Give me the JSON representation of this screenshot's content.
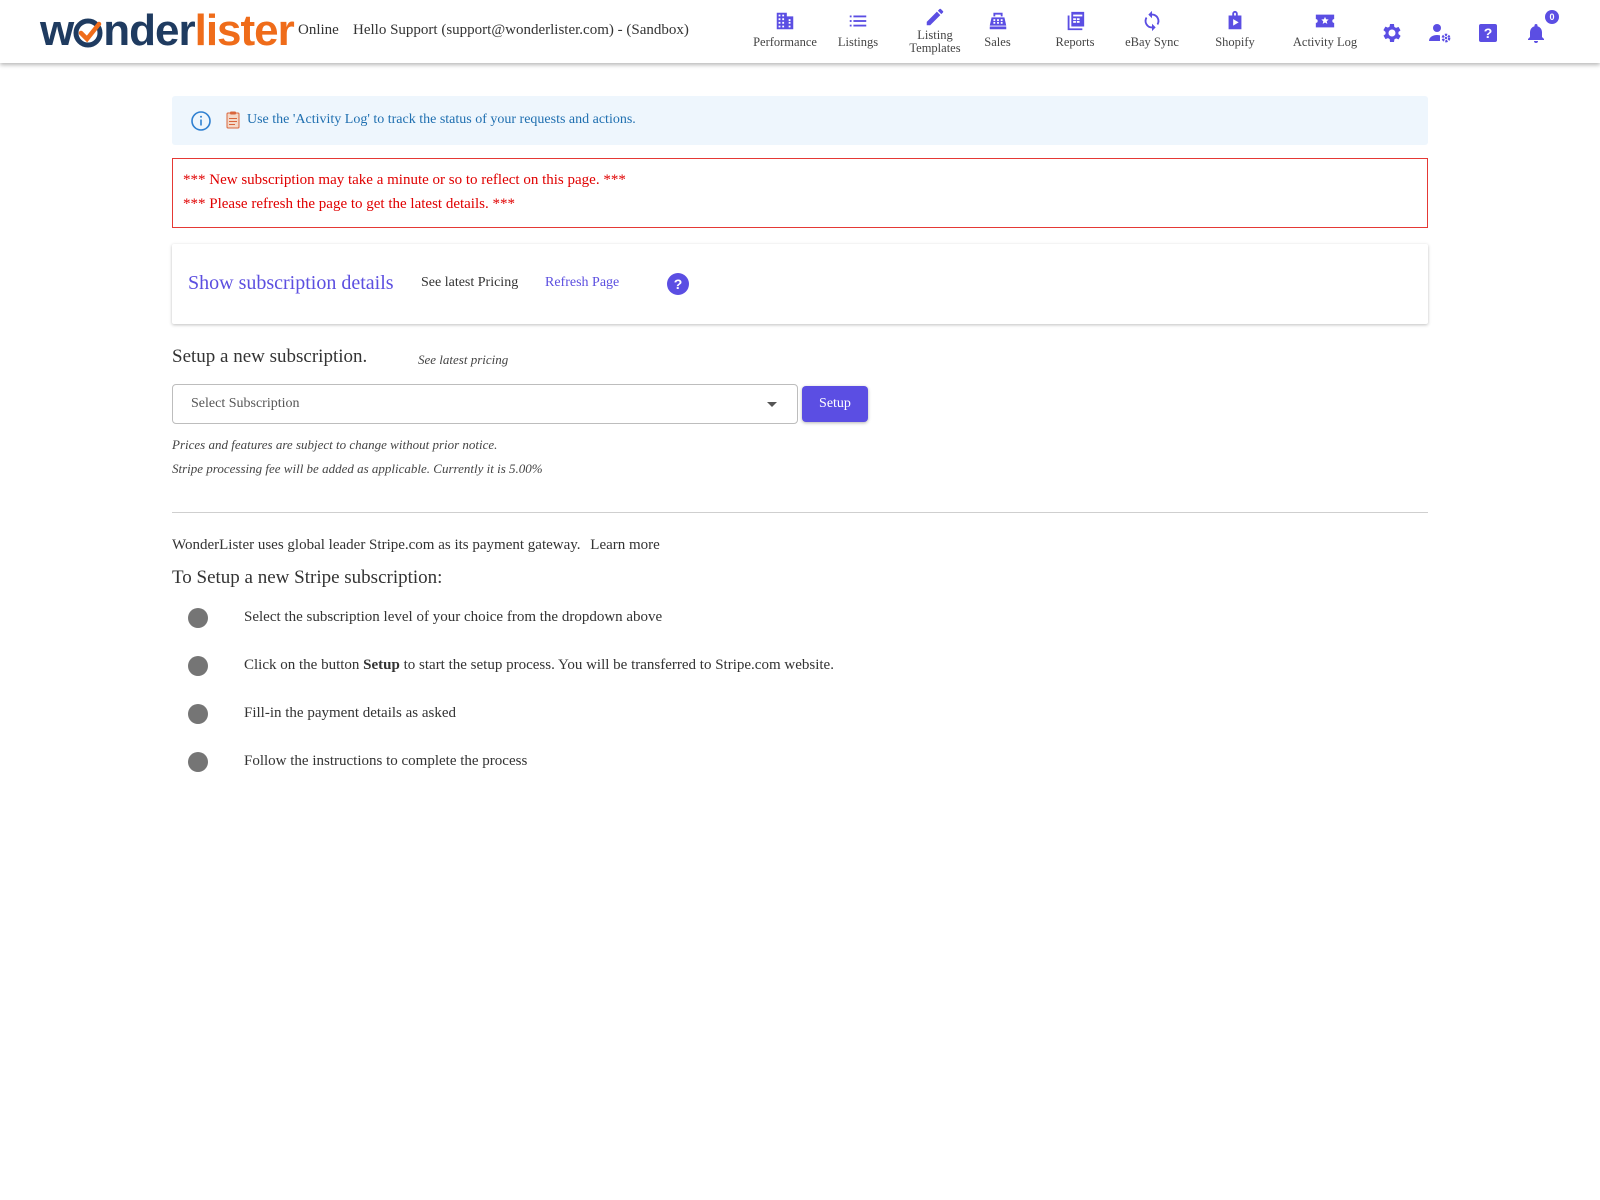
{
  "header": {
    "logo": {
      "part1": "w",
      "part2": "nder",
      "part3": "lister"
    },
    "status": "Online",
    "greeting": "Hello Support (support@wonderlister.com) - (Sandbox)",
    "nav": [
      {
        "label": "Performance",
        "icon": "building-icon"
      },
      {
        "label": "Listings",
        "icon": "list-icon"
      },
      {
        "label_line1": "Listing",
        "label_line2": "Templates",
        "icon": "pencil-icon"
      },
      {
        "label": "Sales",
        "icon": "cash-register-icon"
      },
      {
        "label": "Reports",
        "icon": "reports-icon"
      },
      {
        "label": "eBay Sync",
        "icon": "sync-icon"
      },
      {
        "label": "Shopify",
        "icon": "shopping-bag-icon"
      },
      {
        "label": "Activity Log",
        "icon": "star-ticket-icon"
      }
    ],
    "utility_icons": [
      "gear-icon",
      "user-settings-icon",
      "help-icon",
      "bell-icon"
    ],
    "notification_count": "0",
    "accent_color": "#5b4ee3"
  },
  "info_banner": {
    "text": "Use the 'Activity Log' to track the status of your requests and actions."
  },
  "warning": {
    "line1": "*** New subscription may take a minute or so to reflect on this page. ***",
    "line2": "*** Please refresh the page to get the latest details. ***",
    "color": "#e00000"
  },
  "subscription_card": {
    "show_details": "Show subscription details",
    "see_pricing": "See latest Pricing",
    "refresh": "Refresh Page"
  },
  "setup": {
    "heading": "Setup a new subscription.",
    "pricing_link": "See latest pricing",
    "select_placeholder": "Select Subscription",
    "button": "Setup",
    "note1": "Prices and features are subject to change without prior notice.",
    "note2": "Stripe processing fee will be added as applicable. Currently it is 5.00%"
  },
  "stripe": {
    "gateway_text": "WonderLister uses global leader Stripe.com as its payment gateway.",
    "learn_more": "Learn more",
    "heading": "To Setup a new Stripe subscription:",
    "steps": {
      "s1": "Select the subscription level of your choice from the dropdown above",
      "s2_pre": "Click on the button ",
      "s2_bold": "Setup",
      "s2_post": " to start the setup process. You will be transferred to Stripe.com website.",
      "s3": "Fill-in the payment details as asked",
      "s4": "Follow the instructions to complete the process"
    }
  }
}
